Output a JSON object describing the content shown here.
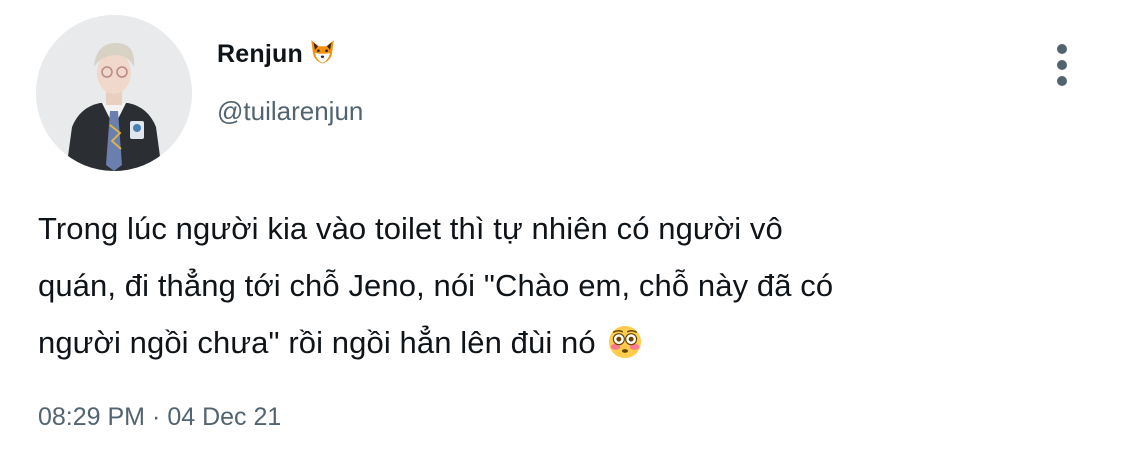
{
  "author": {
    "display_name": "Renjun",
    "name_emoji": "fox-face-emoji",
    "handle": "@tuilarenjun"
  },
  "tweet": {
    "lines": [
      "Trong lúc người kia vào toilet thì tự nhiên có người vô",
      "quán, đi thẳng tới chỗ Jeno, nói \"Chào em, chỗ này đã có",
      "người ngồi chưa\" rồi ngồi hẳn lên đùi nó"
    ],
    "trailing_emoji": "flushed-face-emoji"
  },
  "meta": {
    "time": "08:29 PM",
    "separator": "·",
    "date": "04 Dec 21"
  },
  "icons": {
    "more": "more-vertical-icon"
  },
  "colors": {
    "text_primary": "#0f1419",
    "text_secondary": "#536471",
    "background": "#ffffff"
  }
}
